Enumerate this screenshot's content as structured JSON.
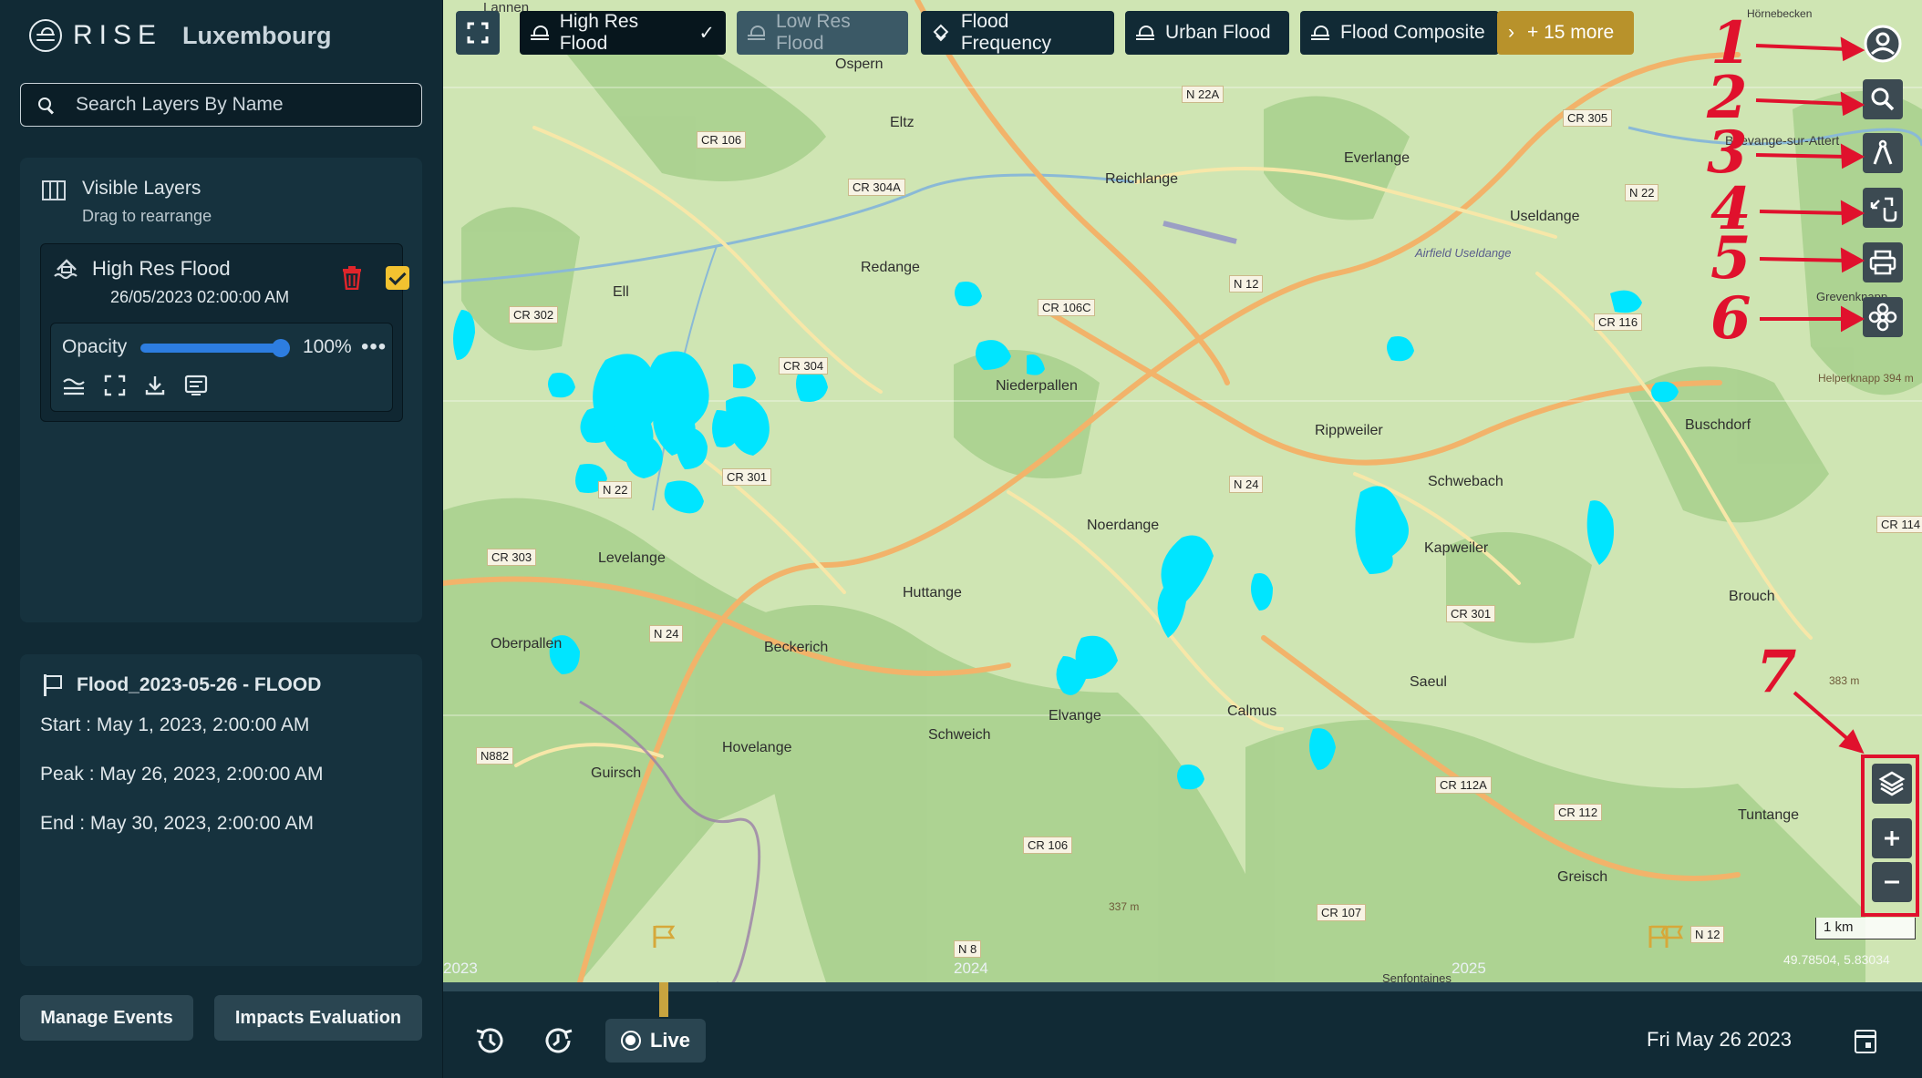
{
  "brand": {
    "name": "RISE",
    "country": "Luxembourg"
  },
  "search": {
    "placeholder": "Search Layers By Name"
  },
  "layers_panel": {
    "title": "Visible Layers",
    "subtitle": "Drag to rearrange",
    "layer": {
      "name": "High Res Flood",
      "date": "26/05/2023 02:00:00 AM",
      "opacity_label": "Opacity",
      "opacity_value": "100%",
      "opacity": 1.0,
      "checked": true,
      "more": "•••"
    }
  },
  "event": {
    "title": "Flood_2023-05-26 - FLOOD",
    "start": "Start : May 1, 2023, 2:00:00 AM",
    "peak": "Peak : May 26, 2023, 2:00:00 AM",
    "end": "End : May 30, 2023, 2:00:00 AM"
  },
  "buttons": {
    "manage": "Manage Events",
    "impacts": "Impacts Evaluation"
  },
  "layer_tabs": [
    {
      "label": "High Res Flood",
      "check": "✓"
    },
    {
      "label": "Low Res Flood"
    },
    {
      "label": "Flood Frequency"
    },
    {
      "label": "Urban Flood"
    },
    {
      "label": "Flood Composite"
    },
    {
      "label": "+ 15 more",
      "chevron": "›"
    }
  ],
  "annotations": [
    "1",
    "2",
    "3",
    "4",
    "5",
    "6",
    "7"
  ],
  "map": {
    "scale": "1 km",
    "coords": "49.78504, 5.83034",
    "years": [
      "2023",
      "2024",
      "2025"
    ],
    "places": [
      "Lannen",
      "Ospern",
      "Eltz",
      "Redange",
      "Ell",
      "Reichlange",
      "Everlange",
      "Useldange",
      "Airfield Useldange",
      "Niederpallen",
      "Rippweiler",
      "Buschdorf",
      "Levelange",
      "Schwebach",
      "Noerdange",
      "Kapweiler",
      "Huttange",
      "Beckerich",
      "Oberpallen",
      "Elvange",
      "Hovelange",
      "Schweich",
      "Calmus",
      "Saeul",
      "Brouch",
      "Guirsch",
      "Tuntange",
      "Greisch",
      "Hörnebecken",
      "Boevange-sur-Attert",
      "Grevenknapp",
      "Helperknapp 394 m",
      "383 m",
      "337 m",
      "Senfontaines"
    ],
    "roads": [
      "CR 106",
      "CR 304A",
      "N 22A",
      "CR 305",
      "N 22",
      "CR 302",
      "CR 106C",
      "N 12",
      "CR 116",
      "CR 304",
      "CR 301",
      "N 22",
      "CR 303",
      "N 24",
      "N 24",
      "CR 301",
      "N882",
      "CR 106",
      "CR 112A",
      "CR 112",
      "CR 107",
      "N 8",
      "N 12",
      "CR 114"
    ]
  },
  "bottom": {
    "live": "Live",
    "date": "Fri May 26 2023",
    "progress": 0.11
  },
  "colors": {
    "flood": "#00e5ff",
    "accent": "#f2c230",
    "annotation": "#e0112d",
    "more": "#b8922b",
    "slider": "#2d7de0"
  }
}
